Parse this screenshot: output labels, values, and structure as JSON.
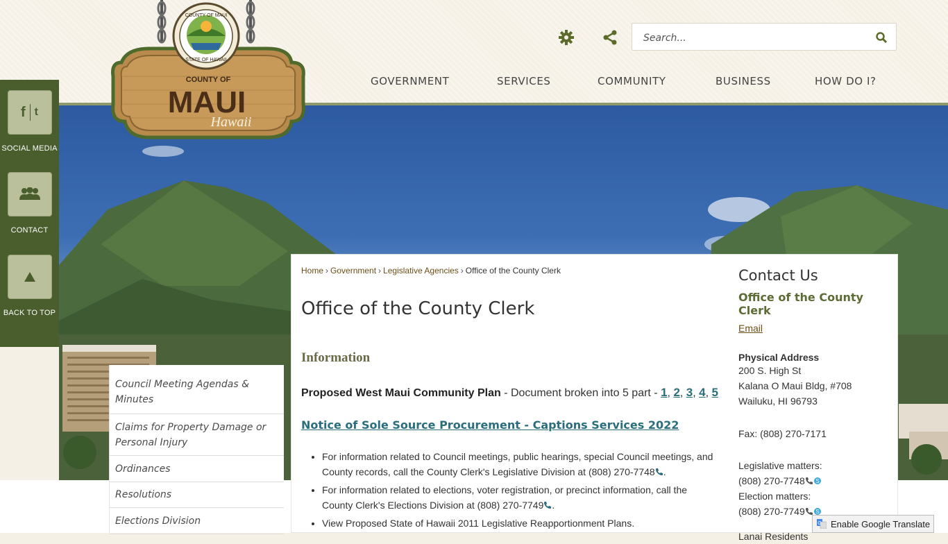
{
  "header": {
    "logo": {
      "seal_text_top": "COUNTY OF MAUI",
      "seal_text_bottom": "STATE OF HAWAII",
      "sign_county": "COUNTY OF",
      "sign_name": "MAUI",
      "sign_script": "Hawaii"
    },
    "utility_icons": [
      "gear-icon",
      "share-icon"
    ],
    "search": {
      "placeholder": "Search..."
    },
    "nav": [
      "GOVERNMENT",
      "SERVICES",
      "COMMUNITY",
      "BUSINESS",
      "HOW DO I?"
    ]
  },
  "rail": [
    {
      "label": "SOCIAL MEDIA",
      "icon": "facebook-twitter-icon"
    },
    {
      "label": "CONTACT",
      "icon": "people-icon"
    },
    {
      "label": "BACK TO TOP",
      "icon": "arrow-up-icon"
    }
  ],
  "subnav": [
    "Council Meeting Agendas & Minutes",
    "Claims for Property Damage or Personal Injury",
    "Ordinances",
    "Resolutions",
    "Elections Division"
  ],
  "breadcrumb": [
    "Home",
    "Government",
    "Legislative Agencies",
    "Office of the County Clerk"
  ],
  "main": {
    "title": "Office of the County Clerk",
    "info_heading": "Information",
    "plan_bold": "Proposed West Maui Community Plan",
    "plan_text": " - Document broken into 5 part - ",
    "plan_parts": [
      "1",
      "2",
      "3",
      "4",
      "5"
    ],
    "notice_link": "Notice of Sole Source Procurement - Captions Services 2022",
    "bullets": [
      "For information related to Council meetings, public hearings, special Council meetings, and County records, call the County Clerk's Legislative Division at (808) 270-7748",
      "For information related to elections, voter registration, or precinct information, call the County Clerk's Elections Division at (808) 270-7749",
      "View Proposed State of Hawaii 2011 Legislative Reapportionment Plans."
    ]
  },
  "contact": {
    "heading": "Contact Us",
    "org": "Office of the County Clerk",
    "email": "Email",
    "address_label": "Physical Address",
    "address_lines": [
      "200 S. High St",
      "Kalana O Maui Bldg, #708",
      "Wailuku, HI 96793"
    ],
    "fax": "Fax: (808) 270-7171",
    "legislative_label": "Legislative matters:",
    "legislative_phone": "(808) 270-7748",
    "election_label": "Election matters:",
    "election_phone": "(808) 270-7749",
    "lanai_partial": "Lanai Residents"
  },
  "translate": {
    "label": "Enable Google Translate"
  },
  "colors": {
    "rail": "#4a5d2c",
    "link_teal": "#2a6d7c",
    "org_green": "#5d6b35",
    "crumb_brown": "#6b4e16"
  }
}
